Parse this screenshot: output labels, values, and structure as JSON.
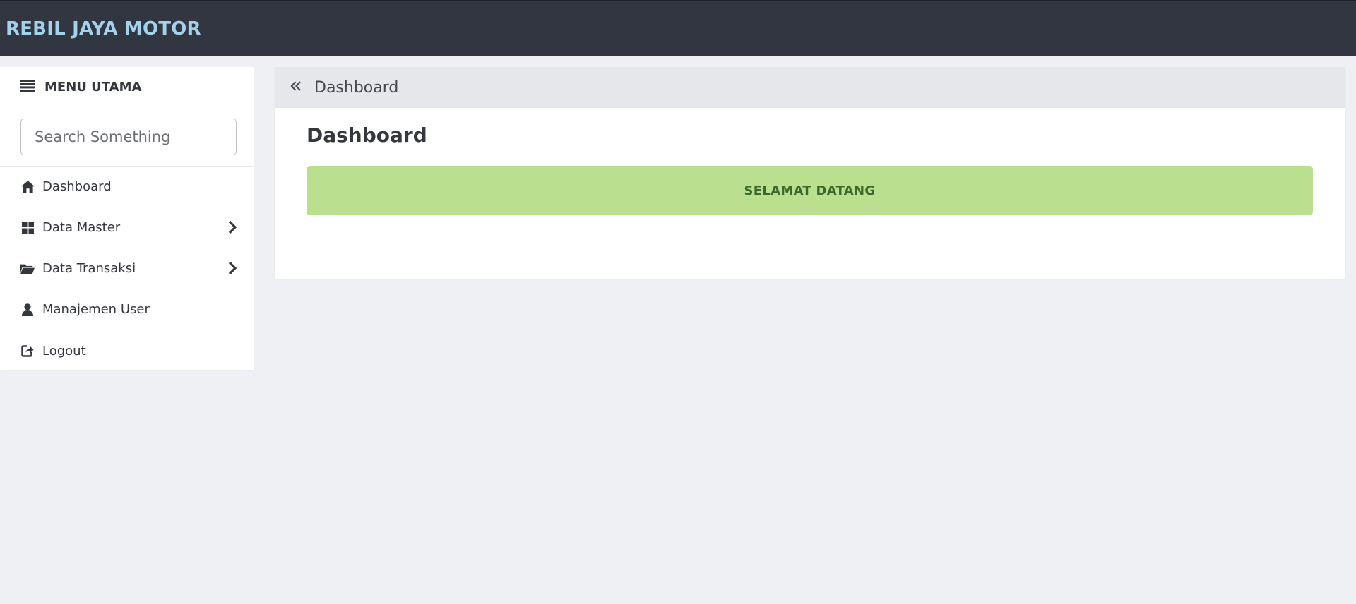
{
  "header": {
    "brand": "REBIL JAYA MOTOR"
  },
  "sidebar": {
    "title": "MENU UTAMA",
    "title_icon": "list-icon",
    "search_placeholder": "Search Something",
    "items": [
      {
        "label": "Dashboard",
        "icon": "home-icon",
        "has_submenu": false
      },
      {
        "label": "Data Master",
        "icon": "grid-icon",
        "has_submenu": true
      },
      {
        "label": "Data Transaksi",
        "icon": "folder-open-icon",
        "has_submenu": true
      },
      {
        "label": "Manajemen User",
        "icon": "user-icon",
        "has_submenu": false
      },
      {
        "label": "Logout",
        "icon": "logout-icon",
        "has_submenu": false
      }
    ]
  },
  "breadcrumb": {
    "label": "Dashboard",
    "icon": "double-chevron-left-icon"
  },
  "main": {
    "title": "Dashboard",
    "welcome_text": "SELAMAT DATANG"
  },
  "colors": {
    "topbar": "#313640",
    "brand": "#a4d1ec",
    "background": "#eff0f4",
    "welcome_bg": "#b9df8f",
    "welcome_text": "#3a6a2b"
  }
}
